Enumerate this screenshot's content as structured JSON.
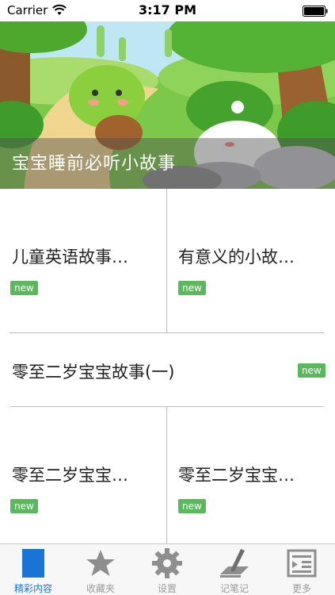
{
  "status_bar": {
    "carrier": "Carrier",
    "time": "3:17 PM"
  },
  "banner": {
    "caption": "宝宝睡前必听小故事"
  },
  "grid": {
    "cells": [
      {
        "title": "儿童英语故事…",
        "badge": "new"
      },
      {
        "title": "有意义的小故…",
        "badge": "new"
      },
      {
        "title": "零至二岁宝宝故事(一)",
        "badge": "new"
      },
      {
        "title": "零至二岁宝宝…",
        "badge": "new"
      },
      {
        "title": "零至二岁宝宝…",
        "badge": "new"
      }
    ]
  },
  "tabbar": {
    "tabs": [
      {
        "label": "精彩内容",
        "icon": "featured-icon",
        "active": true
      },
      {
        "label": "收藏夹",
        "icon": "star-icon",
        "active": false
      },
      {
        "label": "设置",
        "icon": "gear-icon",
        "active": false
      },
      {
        "label": "记笔记",
        "icon": "note-pen-icon",
        "active": false
      },
      {
        "label": "更多",
        "icon": "more-list-icon",
        "active": false
      }
    ]
  },
  "colors": {
    "accent": "#1a74d6",
    "badge": "#5cb85c",
    "tab_inactive": "#9b9b9b"
  }
}
